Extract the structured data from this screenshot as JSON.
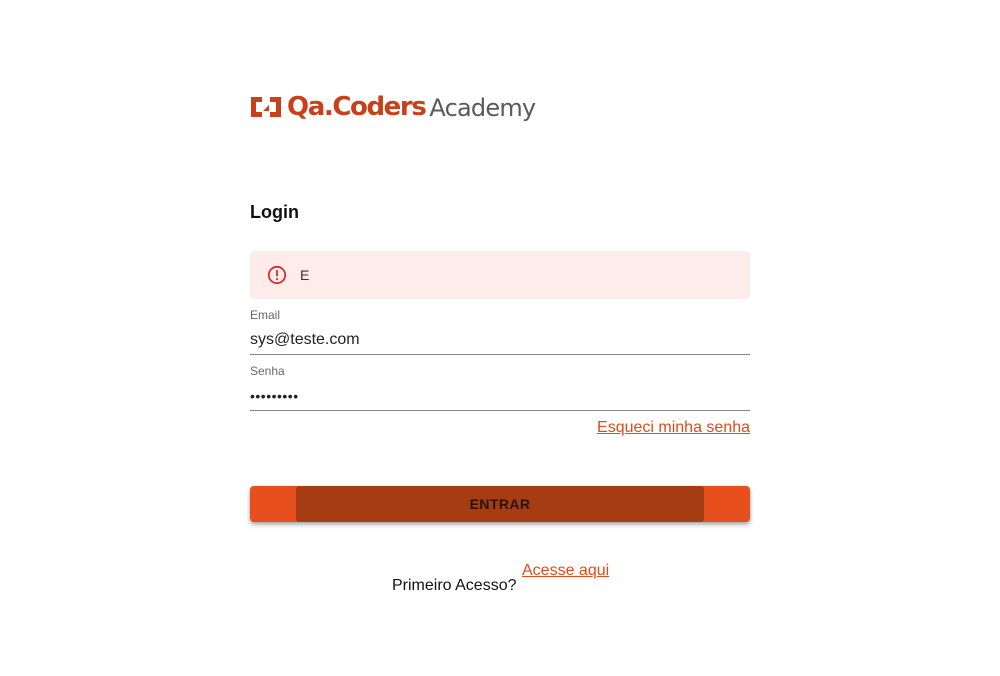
{
  "brand": {
    "name_primary": "Qa.Coders",
    "name_secondary": "Academy",
    "accent_color": "#e84f1e",
    "logo_icon": "brackets-logo-icon"
  },
  "login": {
    "title": "Login",
    "alert": {
      "icon": "error-circle-icon",
      "text": "E",
      "background_color": "#fdecea"
    },
    "email": {
      "label": "Email",
      "value": "sys@teste.com"
    },
    "password": {
      "label": "Senha",
      "value": "•••••••••"
    },
    "forgot_link": "Esqueci minha senha",
    "submit_label": "ENTRAR",
    "first_access_text": "Primeiro Acesso?",
    "first_access_link": "Acesse aqui"
  }
}
